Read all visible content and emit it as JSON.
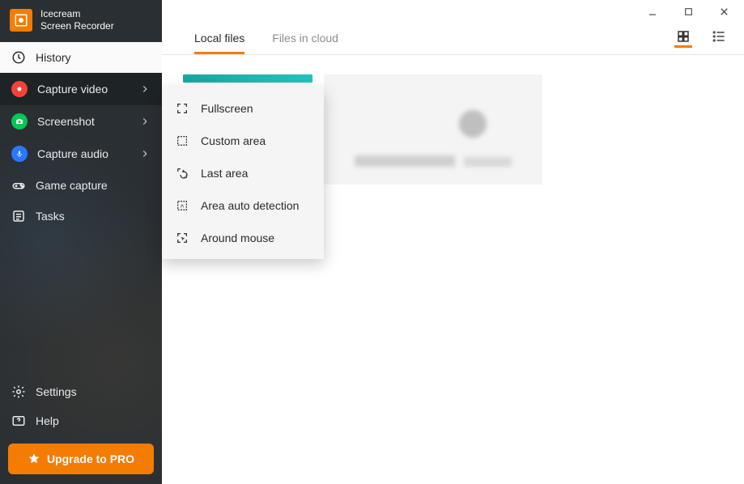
{
  "brand": {
    "line1": "Icecream",
    "line2": "Screen Recorder"
  },
  "sidebar": {
    "items": [
      {
        "label": "History"
      },
      {
        "label": "Capture video"
      },
      {
        "label": "Screenshot"
      },
      {
        "label": "Capture audio"
      },
      {
        "label": "Game capture"
      },
      {
        "label": "Tasks"
      }
    ],
    "bottom": [
      {
        "label": "Settings"
      },
      {
        "label": "Help"
      }
    ],
    "upgrade": "Upgrade to PRO"
  },
  "tabs": {
    "local": "Local files",
    "cloud": "Files in cloud"
  },
  "flyout": {
    "items": [
      {
        "label": "Fullscreen"
      },
      {
        "label": "Custom area"
      },
      {
        "label": "Last area"
      },
      {
        "label": "Area auto detection"
      },
      {
        "label": "Around mouse"
      }
    ]
  },
  "colors": {
    "accent": "#f57c00"
  }
}
